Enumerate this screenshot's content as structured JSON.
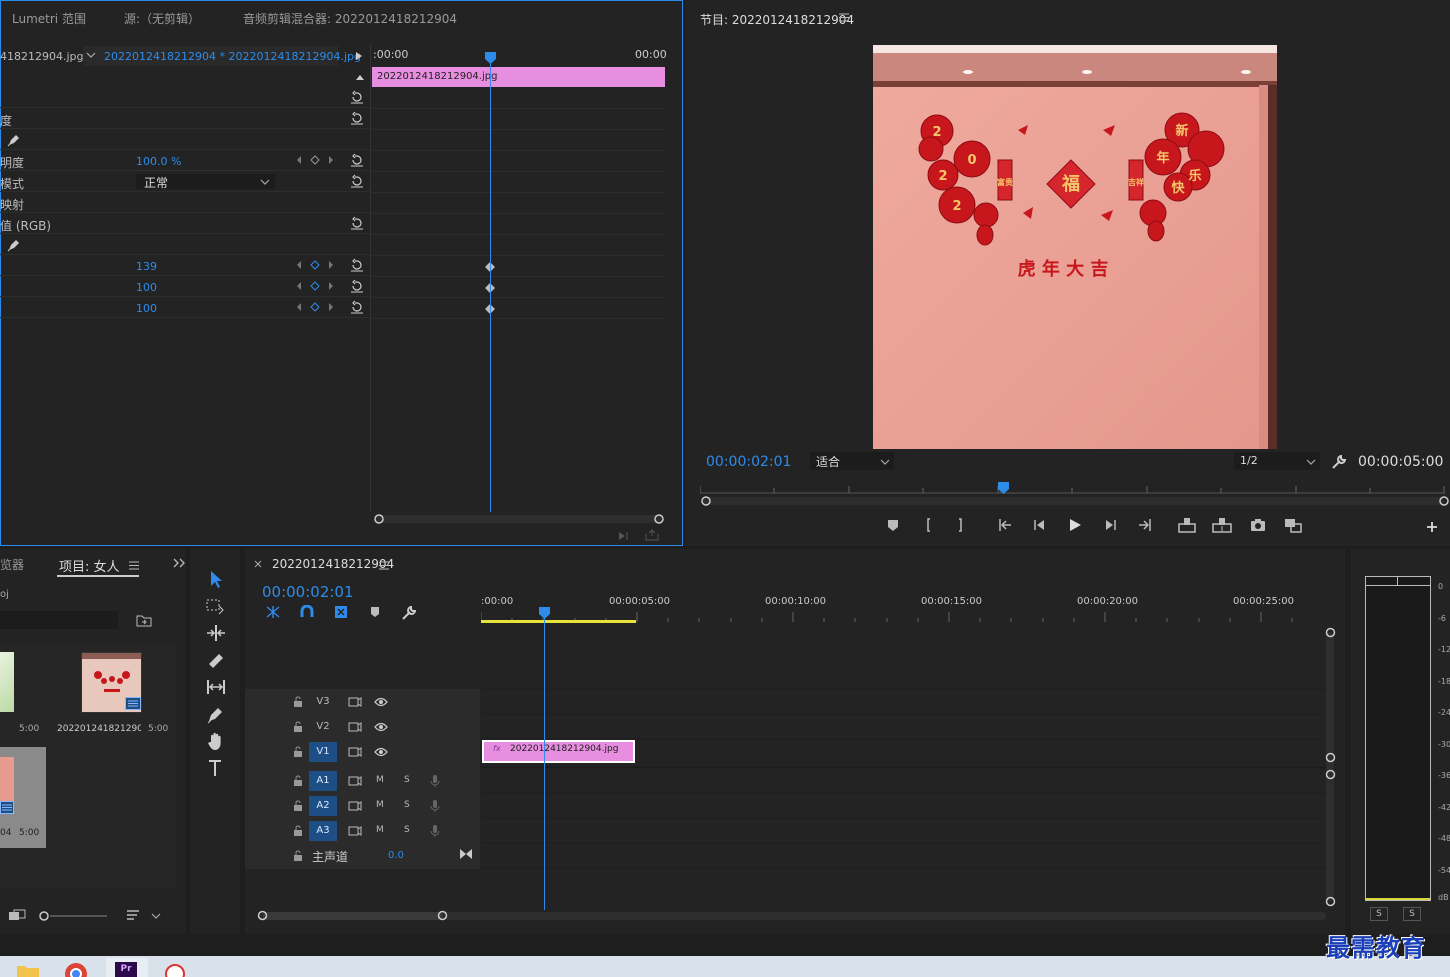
{
  "top_tabs": {
    "lumetri": "Lumetri 范围",
    "source": "源:（无剪辑）",
    "audio_mixer": "音频剪辑混合器: 2022012418212904"
  },
  "effect_controls": {
    "clip_left": "418212904.jpg",
    "clip_right": "2022012418212904 * 2022012418212904.jpg",
    "time_start": ":00:00",
    "time_end": "00:00",
    "clip_bar_label": "2022012418212904.jpg",
    "rows": [
      {
        "label": "度"
      },
      {
        "label": "明度",
        "value": "100.0 %"
      },
      {
        "label": "模式",
        "value": "正常"
      },
      {
        "label": "映射"
      },
      {
        "label": "值 (RGB)"
      },
      {
        "value": "139"
      },
      {
        "value": "100"
      },
      {
        "value": "100"
      }
    ]
  },
  "program": {
    "title": "节目: 2022012418212904",
    "timecode": "00:00:02:01",
    "fit_label": "适合",
    "resolution": "1/2",
    "duration": "00:00:05:00",
    "image": {
      "top_left_chars": [
        "2",
        "0"
      ],
      "fu_char": "福",
      "banner": "虎 年 大 吉",
      "right_chars": [
        "新",
        "年",
        "快",
        "乐"
      ],
      "left_chars": [
        "2",
        "2"
      ],
      "couplet_left": "富贵",
      "couplet_right": "吉祥"
    }
  },
  "project": {
    "tab_left": "览器",
    "title": "项目: 女人",
    "file_label": "oj",
    "items": [
      {
        "name": "",
        "duration": "5:00"
      },
      {
        "name": "2022012418212904...",
        "duration": "5:00"
      },
      {
        "name": "04",
        "duration": "5:00"
      }
    ]
  },
  "timeline": {
    "title": "2022012418212904",
    "timecode": "00:00:02:01",
    "ruler": [
      ":00:00",
      "00:00:05:00",
      "00:00:10:00",
      "00:00:15:00",
      "00:00:20:00",
      "00:00:25:00"
    ],
    "video_tracks": [
      "V3",
      "V2",
      "V1"
    ],
    "audio_tracks": [
      "A1",
      "A2",
      "A3"
    ],
    "master_label": "主声道",
    "master_value": "0.0",
    "clip_label": "2022012418212904.jpg",
    "mute": "M",
    "solo": "S"
  },
  "meter": {
    "scale": [
      "0",
      "-6",
      "-12",
      "-18",
      "-24",
      "-30",
      "-36",
      "-42",
      "-48",
      "-54",
      "dB"
    ],
    "solo_left": "S",
    "solo_right": "S"
  },
  "watermark": "最需教育",
  "colors": {
    "accent_blue": "#2d8ceb",
    "clip_pink": "#e78ee0",
    "track_on": "#1d4e86"
  }
}
